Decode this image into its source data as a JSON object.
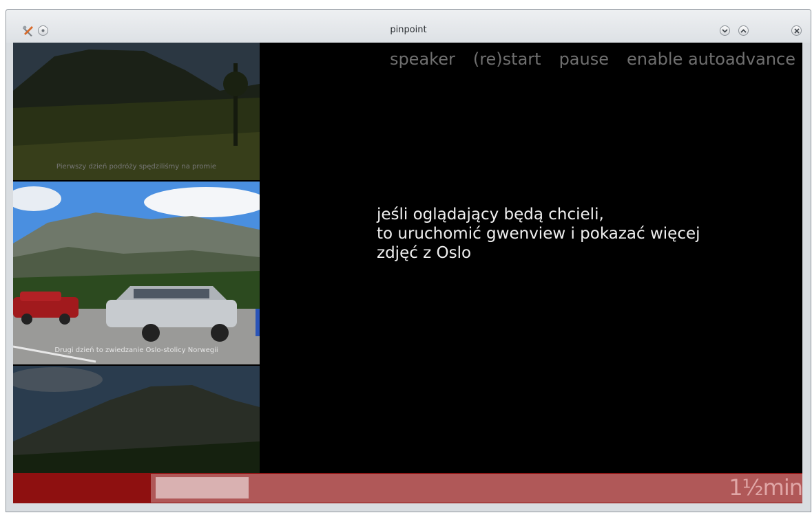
{
  "window": {
    "title": "pinpoint",
    "icons": [
      "tools-icon",
      "pin-icon",
      "minimize-icon",
      "maximize-icon",
      "close-icon"
    ]
  },
  "menu": {
    "speaker": "speaker",
    "restart": "(re)start",
    "pause": "pause",
    "autoadvance": "enable autoadvance"
  },
  "slides": [
    {
      "caption": "Pierwszy dzień podróży spędziliśmy na promie"
    },
    {
      "caption": "Drugi dzień to zwiedzanie Oslo-stolicy Norwegii"
    },
    {
      "caption": ""
    }
  ],
  "notes": {
    "line1": "jeśli oglądający będą chcieli,",
    "line2": "to uruchomić gwenview i pokazać więcej",
    "line3": "zdjęć z Oslo"
  },
  "timer": {
    "label": "1½min",
    "colors": {
      "bar": "#8e1010",
      "track": "#b05858",
      "slide": "#d9b1b1"
    }
  }
}
